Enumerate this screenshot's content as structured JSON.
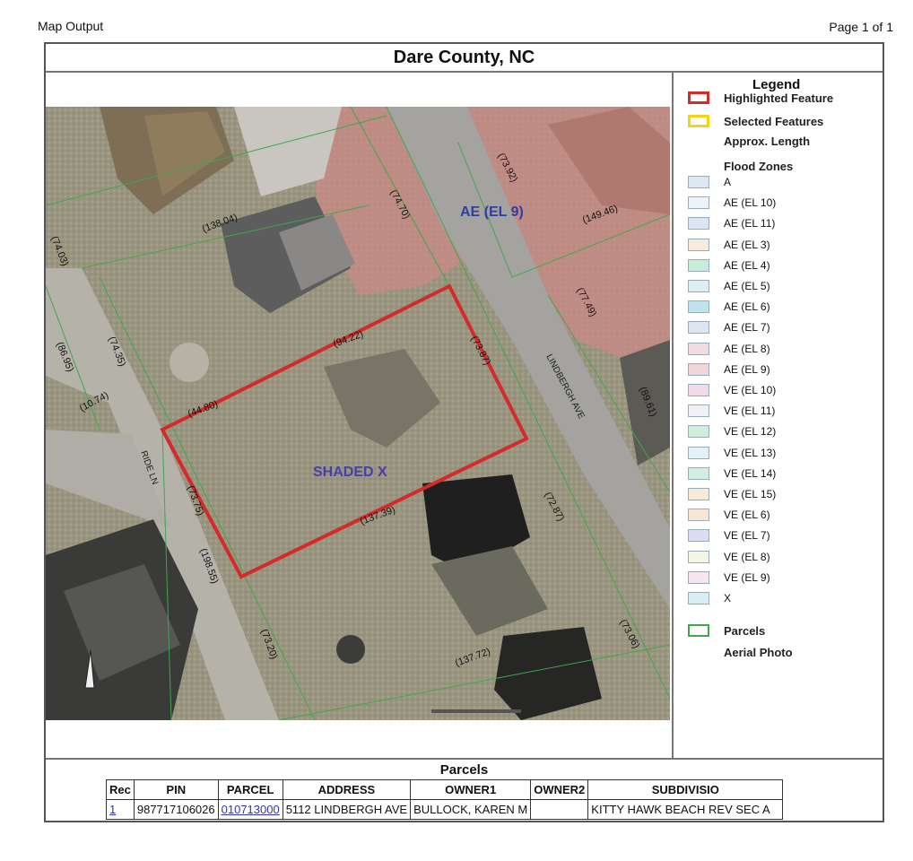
{
  "header": {
    "left": "Map Output",
    "right": "Page 1 of 1"
  },
  "title": "Dare County, NC",
  "map": {
    "zone_labels": [
      "AE (EL 9)",
      "SHADED X"
    ],
    "street_labels": [
      "LINDBERGH AVE",
      "RIDE LN"
    ],
    "lengths": [
      "(138.04)",
      "(74.70)",
      "(73.92)",
      "(149.46)",
      "(74.03)",
      "(94.22)",
      "(73.87)",
      "(77.49)",
      "(86.95)",
      "(74.35)",
      "(10.74)",
      "(44.80)",
      "(89.61)",
      "(73.75)",
      "(137.39)",
      "(72.87)",
      "(198.55)",
      "(73.20)",
      "(137.72)",
      "(73.06)"
    ]
  },
  "legend": {
    "title": "Legend",
    "items": [
      {
        "label": "Highlighted Feature",
        "style": "highlight",
        "color": "#d42a2a"
      },
      {
        "label": "Selected Features",
        "style": "selected",
        "color": "#f2d414"
      },
      {
        "label": "Approx. Length",
        "style": "none"
      },
      {
        "label": "Flood Zones",
        "style": "none"
      },
      {
        "label": "A",
        "style": "fill",
        "color": "#dce9f0"
      },
      {
        "label": "AE (EL 10)",
        "style": "fill",
        "color": "#eef3f8"
      },
      {
        "label": "AE (EL 11)",
        "style": "fill",
        "color": "#dbe6f3"
      },
      {
        "label": "AE (EL 3)",
        "style": "fill",
        "color": "#f7ecdc"
      },
      {
        "label": "AE (EL 4)",
        "style": "fill",
        "color": "#c9eddb"
      },
      {
        "label": "AE (EL 5)",
        "style": "fill",
        "color": "#dcf0f3"
      },
      {
        "label": "AE (EL 6)",
        "style": "fill",
        "color": "#bfe4ea"
      },
      {
        "label": "AE (EL 7)",
        "style": "fill",
        "color": "#dde7f2"
      },
      {
        "label": "AE (EL 8)",
        "style": "fill",
        "color": "#f2dce3"
      },
      {
        "label": "AE (EL 9)",
        "style": "fill",
        "color": "#f3d5d8"
      },
      {
        "label": "VE (EL 10)",
        "style": "fill",
        "color": "#f1dbe8"
      },
      {
        "label": "VE (EL 11)",
        "style": "fill",
        "color": "#f2f0f7"
      },
      {
        "label": "VE (EL 12)",
        "style": "fill",
        "color": "#cfeedd"
      },
      {
        "label": "VE (EL 13)",
        "style": "fill",
        "color": "#e3f2f8"
      },
      {
        "label": "VE (EL 14)",
        "style": "fill",
        "color": "#d2f0e2"
      },
      {
        "label": "VE (EL 15)",
        "style": "fill",
        "color": "#f5ebd7"
      },
      {
        "label": "VE (EL 6)",
        "style": "fill",
        "color": "#f6e6d4"
      },
      {
        "label": "VE (EL 7)",
        "style": "fill",
        "color": "#dcdcf2"
      },
      {
        "label": "VE (EL 8)",
        "style": "fill",
        "color": "#f3f7e4"
      },
      {
        "label": "VE (EL 9)",
        "style": "fill",
        "color": "#f5e6ef"
      },
      {
        "label": "X",
        "style": "fill",
        "color": "#d7eef2"
      },
      {
        "label": "Parcels",
        "style": "outline",
        "color": "#3fa84a"
      },
      {
        "label": "Aerial Photo",
        "style": "none"
      }
    ]
  },
  "parcels": {
    "title": "Parcels",
    "columns": [
      "Rec",
      "PIN",
      "PARCEL",
      "ADDRESS",
      "OWNER1",
      "OWNER2",
      "SUBDIVISIO"
    ],
    "rows": [
      {
        "rec": "1",
        "pin": "987717106026",
        "parcel": "010713000",
        "address": "5112 LINDBERGH AVE",
        "owner1": "BULLOCK, KAREN M",
        "owner2": "",
        "subdivision": "KITTY HAWK BEACH REV SEC A"
      }
    ]
  }
}
